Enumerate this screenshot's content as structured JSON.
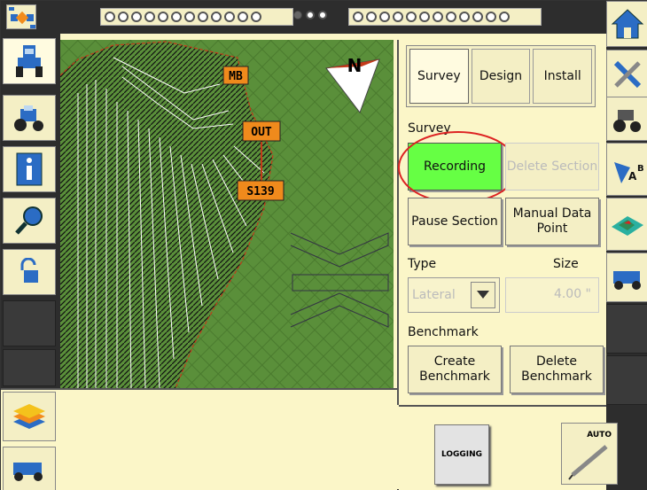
{
  "header": {
    "led_group_left_count": 12,
    "led_group_right_count": 12
  },
  "left_sidebar": {
    "items": [
      {
        "name": "tractor-setup",
        "icon": "tractor-front-icon"
      },
      {
        "name": "vehicle",
        "icon": "tractor-icon"
      },
      {
        "name": "info",
        "icon": "info-icon"
      },
      {
        "name": "search",
        "icon": "magnifier-icon"
      },
      {
        "name": "unlock",
        "icon": "padlock-open-icon"
      }
    ]
  },
  "map": {
    "markers": [
      {
        "label": "MB"
      },
      {
        "label": "OUT"
      },
      {
        "label": "S139"
      }
    ],
    "compass_label": "N",
    "colors": {
      "field": "#5a8f3a",
      "marker": "#f08a1c",
      "boundary": "#c43a1a"
    }
  },
  "panel": {
    "tabs": [
      {
        "label": "Survey",
        "active": true
      },
      {
        "label": "Design",
        "active": false
      },
      {
        "label": "Install",
        "active": false
      }
    ],
    "survey_section_label": "Survey",
    "recording_label": "Recording",
    "delete_section_label": "Delete Section",
    "pause_section_label": "Pause Section",
    "manual_point_label": "Manual Data Point",
    "type_label": "Type",
    "size_label": "Size",
    "type_value": "Lateral",
    "size_value": "4.00 \"",
    "benchmark_label": "Benchmark",
    "create_benchmark_label": "Create Benchmark",
    "delete_benchmark_label": "Delete Benchmark",
    "recording_color": "#66ff44"
  },
  "bottom": {
    "logging_label": "LOGGING",
    "auto_label": "AUTO"
  },
  "right_sidebar": {
    "items": [
      {
        "name": "home",
        "icon": "home-icon"
      },
      {
        "name": "tools",
        "icon": "wrench-screwdriver-icon"
      },
      {
        "name": "vehicle",
        "icon": "tractor-icon"
      },
      {
        "name": "benchmark-ab",
        "icon": "ab-line-icon"
      },
      {
        "name": "terrain",
        "icon": "terrain-map-icon"
      },
      {
        "name": "implement",
        "icon": "scraper-icon"
      }
    ]
  }
}
